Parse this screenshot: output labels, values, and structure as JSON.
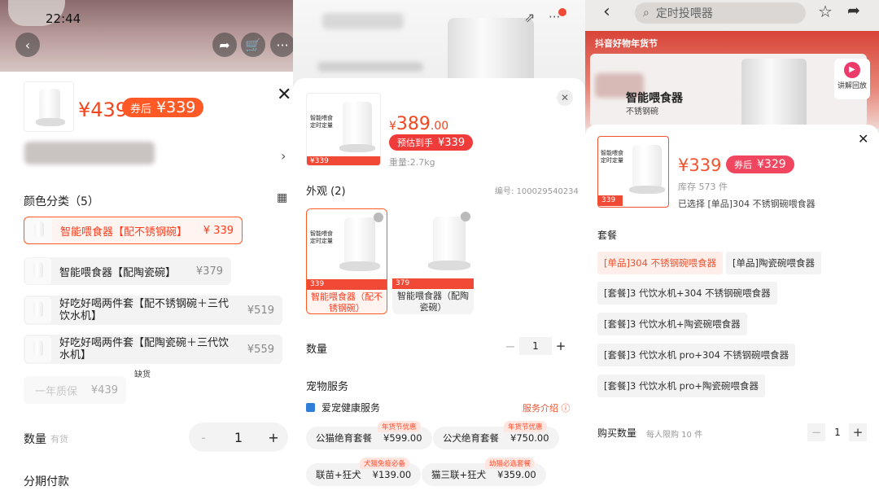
{
  "p1": {
    "time": "22:44",
    "price": "¥439",
    "coupon_label": "券后",
    "coupon_price": "¥339",
    "section_title": "颜色分类（5）",
    "options": [
      {
        "label": "智能喂食器【配不锈钢碗】",
        "price": "¥ 339",
        "selected": true
      },
      {
        "label": "智能喂食器【配陶瓷碗】",
        "price": "¥379"
      },
      {
        "label": "好吃好喝两件套【配不锈钢碗＋三代饮水机】",
        "price": "¥519"
      },
      {
        "label": "好吃好喝两件套【配陶瓷碗＋三代饮水机】",
        "price": "¥559"
      }
    ],
    "warranty": {
      "label": "一年质保",
      "price": "¥439",
      "badge": "缺货"
    },
    "qty_label": "数量",
    "qty_status": "有货",
    "qty_minus": "-",
    "qty_value": "1",
    "qty_plus": "+",
    "installment_label": "分期付款"
  },
  "p2": {
    "price_symbol": "¥",
    "price_int": "389",
    "price_dec": ".00",
    "est_label": "预估到手",
    "est_price": "¥339",
    "weight": "重量:2.7kg",
    "appearance_title": "外观 (2)",
    "code_label": "编号:",
    "code_value": "100029540234",
    "cards": [
      {
        "caption": "智能喂食器（配不锈钢碗）",
        "band": "339",
        "selected": true
      },
      {
        "caption": "智能喂食器（配陶瓷碗）",
        "band": "379"
      }
    ],
    "card_text": "智能喂食\n定时定量",
    "qty_label": "数量",
    "qty_minus": "−",
    "qty_value": "1",
    "qty_plus": "+",
    "pet_service_title": "宠物服务",
    "health_service": "爱宠健康服务",
    "service_intro": "服务介绍",
    "services": [
      {
        "name": "公猫绝育套餐",
        "price": "¥599.00",
        "tag": "年货节优惠"
      },
      {
        "name": "公犬绝育套餐",
        "price": "¥750.00",
        "tag": "年货节优惠"
      },
      {
        "name": "联苗+狂犬",
        "price": "¥139.00",
        "tag": "犬猫免疫必备"
      },
      {
        "name": "猫三联+狂犬",
        "price": "¥359.00",
        "tag": "幼猫必选套餐"
      }
    ]
  },
  "p3": {
    "search_placeholder": "定时投喂器",
    "banner_text": "抖音好物年货节",
    "product_name": "智能喂食器",
    "product_sub": "不锈钢碗",
    "replay_label": "讲解回放",
    "price": "¥339",
    "coupon_label": "券后",
    "coupon_price": "¥329",
    "stock": "库存 573 件",
    "selected_text": "已选择 [单品]304 不锈钢碗喂食器",
    "package_title": "套餐",
    "packages": [
      {
        "label": "[单品]304 不锈钢碗喂食器",
        "selected": true
      },
      {
        "label": "[单品]陶瓷碗喂食器"
      },
      {
        "label": "[套餐]3 代饮水机+304 不锈钢碗喂食器"
      },
      {
        "label": "[套餐]3 代饮水机+陶瓷碗喂食器"
      },
      {
        "label": "[套餐]3 代饮水机 pro+304 不锈钢碗喂食器"
      },
      {
        "label": "[套餐]3 代饮水机 pro+陶瓷碗喂食器"
      }
    ],
    "buy_qty_label": "购买数量",
    "limit_text": "每人限购 10 件",
    "qty_minus": "−",
    "qty_value": "1",
    "qty_plus": "+",
    "thumb_band": "339"
  },
  "colors": {
    "accent": "#ff5a26",
    "accent_text": "#ff3d1f",
    "promo_red": "#f04a36"
  }
}
